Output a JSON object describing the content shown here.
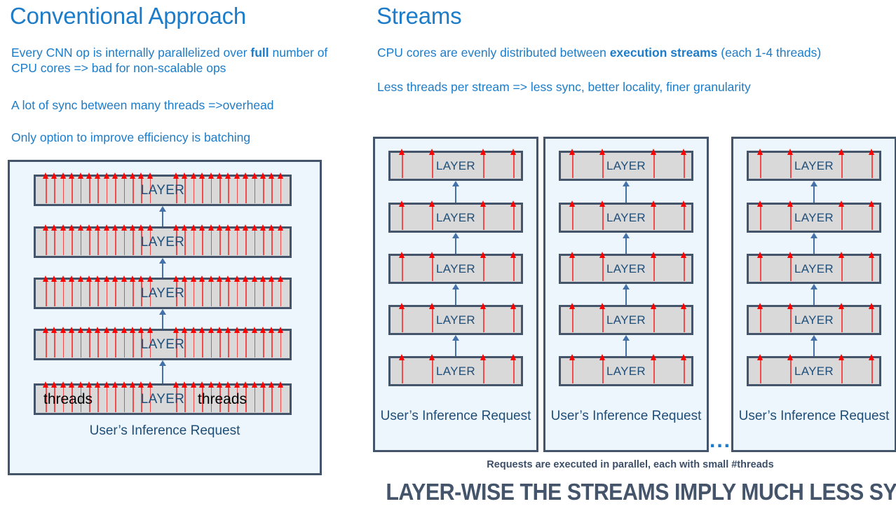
{
  "left": {
    "heading": "Conventional Approach",
    "bullets": [
      {
        "pre": "Every CNN op is internally parallelized over ",
        "bold": "full",
        "post": " number of CPU cores => bad for non-scalable ops"
      },
      {
        "pre": "A lot of sync between many threads =>overhead",
        "bold": "",
        "post": ""
      },
      {
        "pre": "Only option to improve efficiency is batching",
        "bold": "",
        "post": ""
      }
    ],
    "diagram": {
      "layer_label": "LAYER",
      "threads_label_left": "threads",
      "threads_label_right": "threads",
      "caption": "User’s Inference Request",
      "layer_count": 5,
      "arrows_per_side": 13
    }
  },
  "right": {
    "heading": "Streams",
    "bullets": [
      {
        "pre": "CPU cores are evenly distributed between ",
        "bold": "execution streams",
        "post": " (each 1-4 threads)"
      },
      {
        "pre": "Less threads per stream => less sync, better locality, finer granularity",
        "bold": "",
        "post": ""
      }
    ],
    "streams": [
      {
        "layer_label": "LAYER",
        "caption": "User’s Inference Request",
        "layer_count": 5,
        "arrows_per_side": 2
      },
      {
        "layer_label": "LAYER",
        "caption": "User’s Inference Request",
        "layer_count": 5,
        "arrows_per_side": 2
      },
      {
        "layer_label": "LAYER",
        "caption": "User’s Inference Request",
        "layer_count": 5,
        "arrows_per_side": 2
      }
    ],
    "ellipsis": "...",
    "subcaption": "Requests are executed in parallel, each with small #threads",
    "bigcaption": "LAYER-WISE THE STREAMS  IMPLY MUCH LESS SYNCH"
  },
  "colors": {
    "heading_blue": "#1C7CC9",
    "body_blue": "#1C7CC9",
    "layer_text": "#1F4E79",
    "layer_fill": "#D9D9D9",
    "layer_border": "#44546A",
    "panel_fill": "#EEF6FD",
    "panel_border": "#44546A",
    "thread_arrow_red": "#FF0000",
    "connector_blue": "#4472A8",
    "caption_slate": "#44546A",
    "threads_text": "#000000"
  }
}
